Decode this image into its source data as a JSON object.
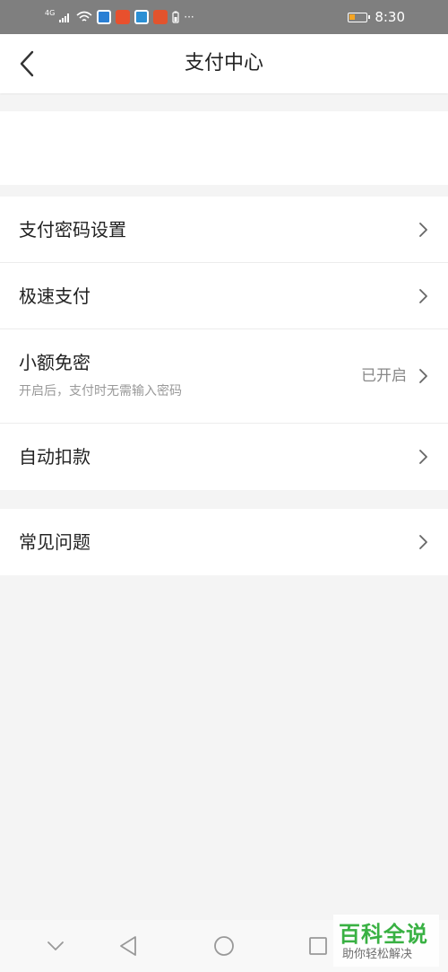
{
  "status_bar": {
    "signal_label": "4G",
    "time": "8:30",
    "more": "···",
    "battery_level": 0.25,
    "app_icon_colors": [
      "#2a7fd4",
      "#e8502d",
      "#2a8fd4",
      "#e2532d"
    ]
  },
  "header": {
    "title": "支付中心",
    "back_icon": "chevron-left-icon"
  },
  "menu_group_1": [
    {
      "label": "支付密码设置"
    },
    {
      "label": "极速支付"
    },
    {
      "label": "小额免密",
      "subtitle": "开启后，支付时无需输入密码",
      "value": "已开启"
    },
    {
      "label": "自动扣款"
    }
  ],
  "menu_group_2": [
    {
      "label": "常见问题"
    }
  ],
  "bottom_nav": {
    "icons": [
      "chevron-down-icon",
      "back-triangle-icon",
      "home-circle-icon",
      "recents-square-icon"
    ]
  },
  "watermark": {
    "title": "百科全说",
    "subtitle": "助你轻松解决",
    "color": "#2fae3a"
  },
  "colors": {
    "background": "#f4f4f4",
    "status_bar": "#7f7f7f",
    "card": "#ffffff",
    "divider": "#ececec",
    "secondary_text": "#999999"
  }
}
